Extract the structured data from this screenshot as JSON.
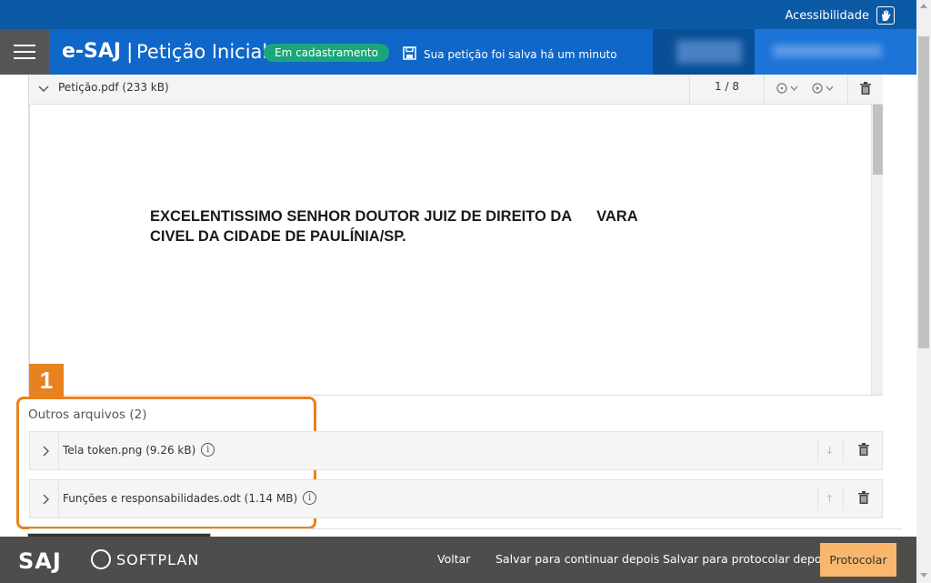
{
  "topbar": {
    "accessibility_label": "Acessibilidade"
  },
  "header": {
    "brand": "e-SAJ",
    "separator": "|",
    "title": "Petição Inicial",
    "status_badge": "Em cadastramento",
    "save_status": "Sua petição foi salva há um minuto"
  },
  "pdf": {
    "file_name": "Petição.pdf (233 kB)",
    "page_indicator": "1 / 8",
    "content": "EXCELENTISSIMO SENHOR DOUTOR JUIZ DE DIREITO DA      VARA\nCIVEL DA CIDADE DE PAULÍNIA/SP."
  },
  "annotation": {
    "marker_number": "1"
  },
  "others": {
    "title": "Outros arquivos (2)",
    "files": [
      {
        "name": "Tela token.png (9.26 kB)",
        "info_icon": "info-icon",
        "arrow": "↓"
      },
      {
        "name": "Funções e responsabilidades.odt (1.14 MB)",
        "info_icon": "info-icon",
        "arrow": "↑"
      }
    ]
  },
  "footer": {
    "logo_saj": "SAJ",
    "logo_softplan": "SOFTPLAN",
    "back_label": "Voltar",
    "save_later_label": "Salvar para continuar depois",
    "save_protocol_label": "Salvar para protocolar depois",
    "protocol_label": "Protocolar"
  },
  "colors": {
    "topbar": "#0b5aa6",
    "header": "#0e67c9",
    "badge": "#1aa67a",
    "annotation": "#e8821e",
    "footer": "#4f4d4b",
    "primary_action": "#f8b76c"
  }
}
